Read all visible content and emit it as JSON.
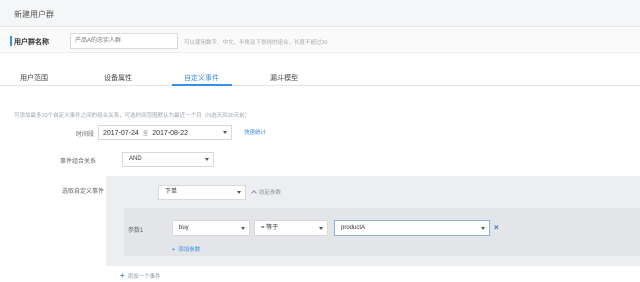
{
  "header": {
    "title": "新建用户群"
  },
  "group_name": {
    "label": "用户群名称",
    "placeholder": "产品A的忠实人群",
    "hint": "可以使用数字、中文、半角及下划线的组合，长度不超过30"
  },
  "tabs": [
    {
      "label": "用户范围",
      "active": false
    },
    {
      "label": "设备属性",
      "active": false
    },
    {
      "label": "自定义事件",
      "active": true
    },
    {
      "label": "漏斗模型",
      "active": false
    }
  ],
  "note": "可添加最多10个自定义事件之间的组合关系，可选时间范围默认为最近一个月（N选天到30天前）",
  "time": {
    "label": "时间段",
    "start": "2017-07-24",
    "separator": "至",
    "end": "2017-08-22",
    "extra_link": "快速统计"
  },
  "relation": {
    "label": "事件组合关系",
    "value": "AND"
  },
  "event": {
    "label": "选取自定义事件",
    "value": "下单",
    "collapse_label": "收起参数",
    "param": {
      "label": "参数1",
      "name": "buy",
      "operator": "= 等于",
      "value": "productA",
      "delete_icon": "×"
    },
    "add_param_label": "添加参数"
  },
  "add_event_label": "添加一个事件",
  "colors": {
    "accent": "#3a8ee6",
    "panel": "#eceef1"
  }
}
